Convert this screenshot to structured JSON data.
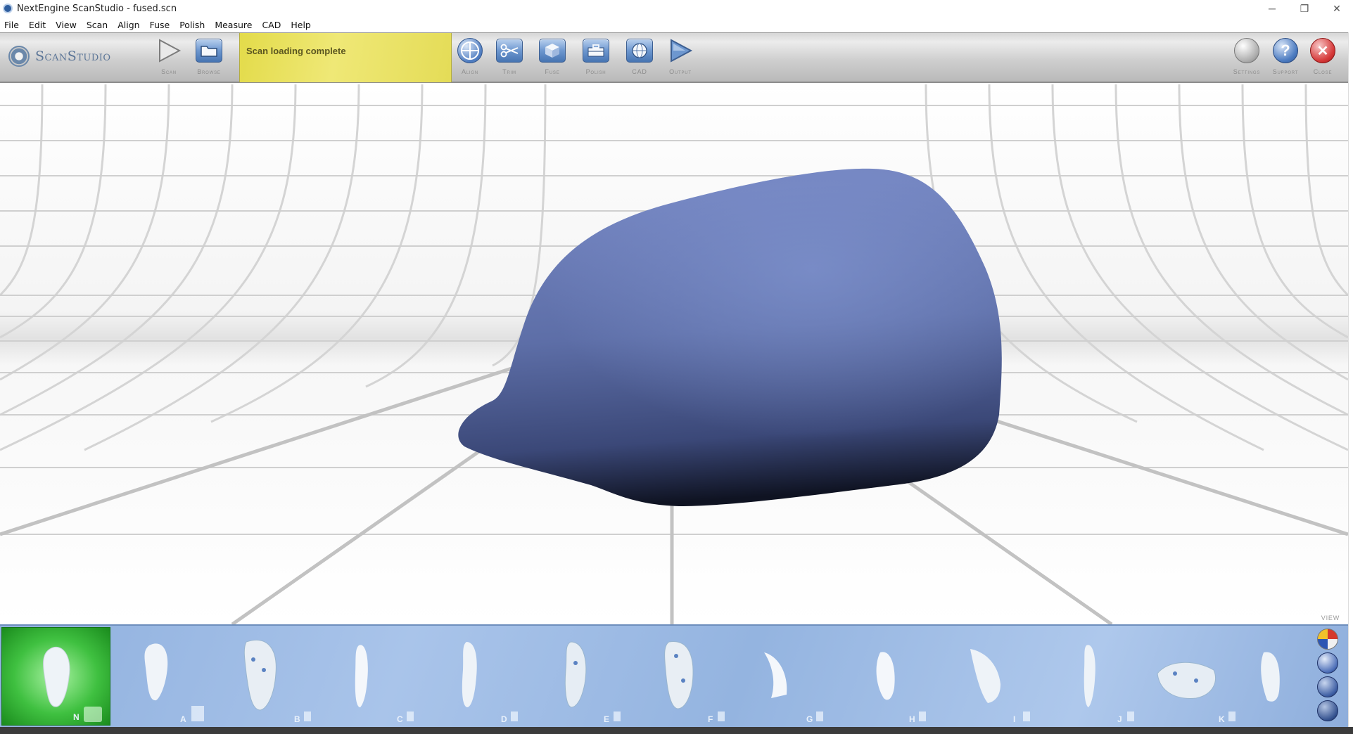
{
  "window": {
    "title": "NextEngine ScanStudio - fused.scn",
    "minimize": "─",
    "restore": "❐",
    "close": "✕"
  },
  "menu": [
    "File",
    "Edit",
    "View",
    "Scan",
    "Align",
    "Fuse",
    "Polish",
    "Measure",
    "CAD",
    "Help"
  ],
  "toolbar": {
    "logo_text": "ScanStudio",
    "scan_label": "Scan",
    "browse_label": "Browse",
    "status": "Scan loading complete",
    "align_label": "Align",
    "trim_label": "Trim",
    "fuse_label": "Fuse",
    "polish_label": "Polish",
    "cad_label": "CAD",
    "output_label": "Output",
    "settings_label": "Settings",
    "support_label": "Support",
    "close_label": "Close"
  },
  "viewport": {
    "view_label": "VIEW",
    "model_color": "#6477b0"
  },
  "thumbnails": {
    "selected": "N",
    "items": [
      "A",
      "B",
      "C",
      "D",
      "E",
      "F",
      "G",
      "H",
      "I",
      "J",
      "K"
    ]
  },
  "colors": {
    "status_yellow": "#e8e05a",
    "selected_green": "#3fc040",
    "strip_blue": "#9db9e4"
  }
}
